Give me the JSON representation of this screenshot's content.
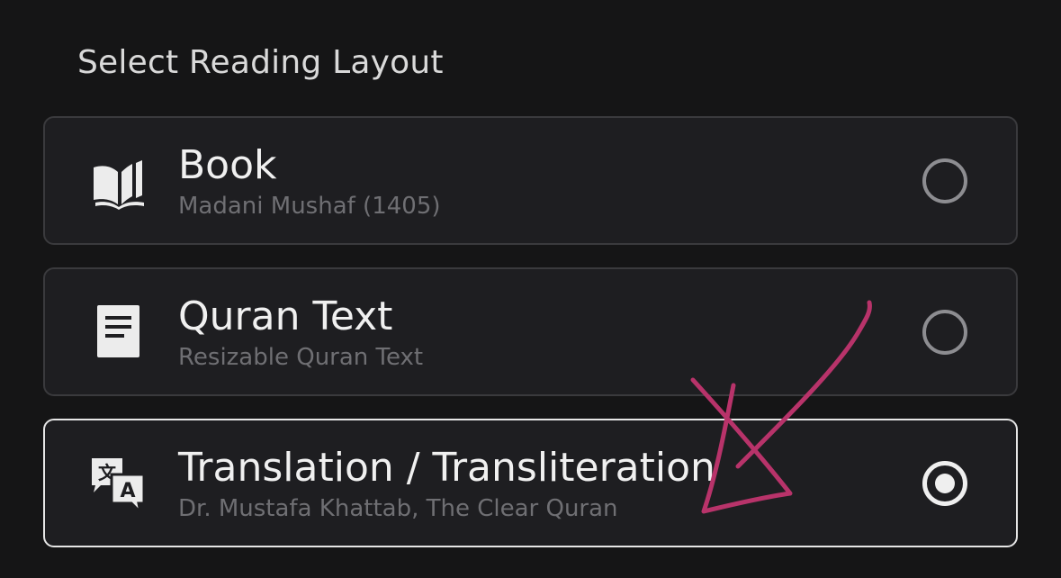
{
  "header": {
    "title": "Select Reading Layout"
  },
  "options": [
    {
      "label": "Book",
      "subtitle": "Madani Mushaf (1405)",
      "icon": "book-icon",
      "selected": false
    },
    {
      "label": "Quran Text",
      "subtitle": "Resizable Quran Text",
      "icon": "document-icon",
      "selected": false
    },
    {
      "label": "Translation / Transliteration",
      "subtitle": "Dr. Mustafa Khattab, The Clear Quran",
      "icon": "translate-icon",
      "selected": true
    }
  ],
  "colors": {
    "background": "#151516",
    "card": "#1e1e21",
    "card_border": "#3a3a3d",
    "selected_border": "#e6e6e6",
    "subtitle": "#6f6f73",
    "annotation_stroke": "#b8336a"
  },
  "annotation": {
    "type": "hand-drawn-arrow",
    "points_to": "Translation / Transliteration"
  }
}
